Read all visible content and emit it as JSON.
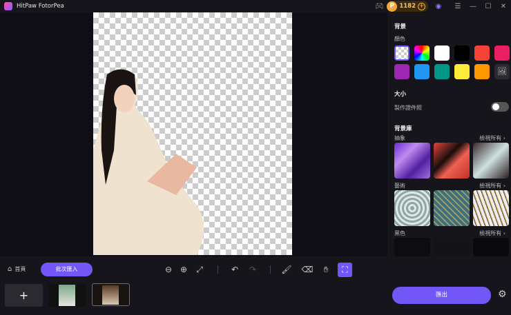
{
  "app": {
    "title": "HitPaw FotorPea",
    "coins": "1182"
  },
  "panel": {
    "background_heading": "背景",
    "color_label": "顏色",
    "colors_row1": [
      "transparent",
      "rainbow",
      "#ffffff",
      "#000000",
      "#f44336",
      "#e91e63"
    ],
    "colors_row2": [
      "#9c27b0",
      "#2196f3",
      "#009688",
      "#ffeb3b",
      "#ff9800"
    ],
    "size_heading": "大小",
    "id_photo_label": "製作證件照",
    "id_photo_on": false,
    "library_heading": "背景庫",
    "categories": [
      {
        "name": "抽象",
        "view_all": "檢視所有"
      },
      {
        "name": "藝術",
        "view_all": "檢視所有"
      },
      {
        "name": "黑色",
        "view_all": "檢視所有"
      }
    ]
  },
  "bottom": {
    "home_label": "首頁",
    "batch_import_label": "批次匯入",
    "export_label": "匯出",
    "add_label": "+"
  }
}
